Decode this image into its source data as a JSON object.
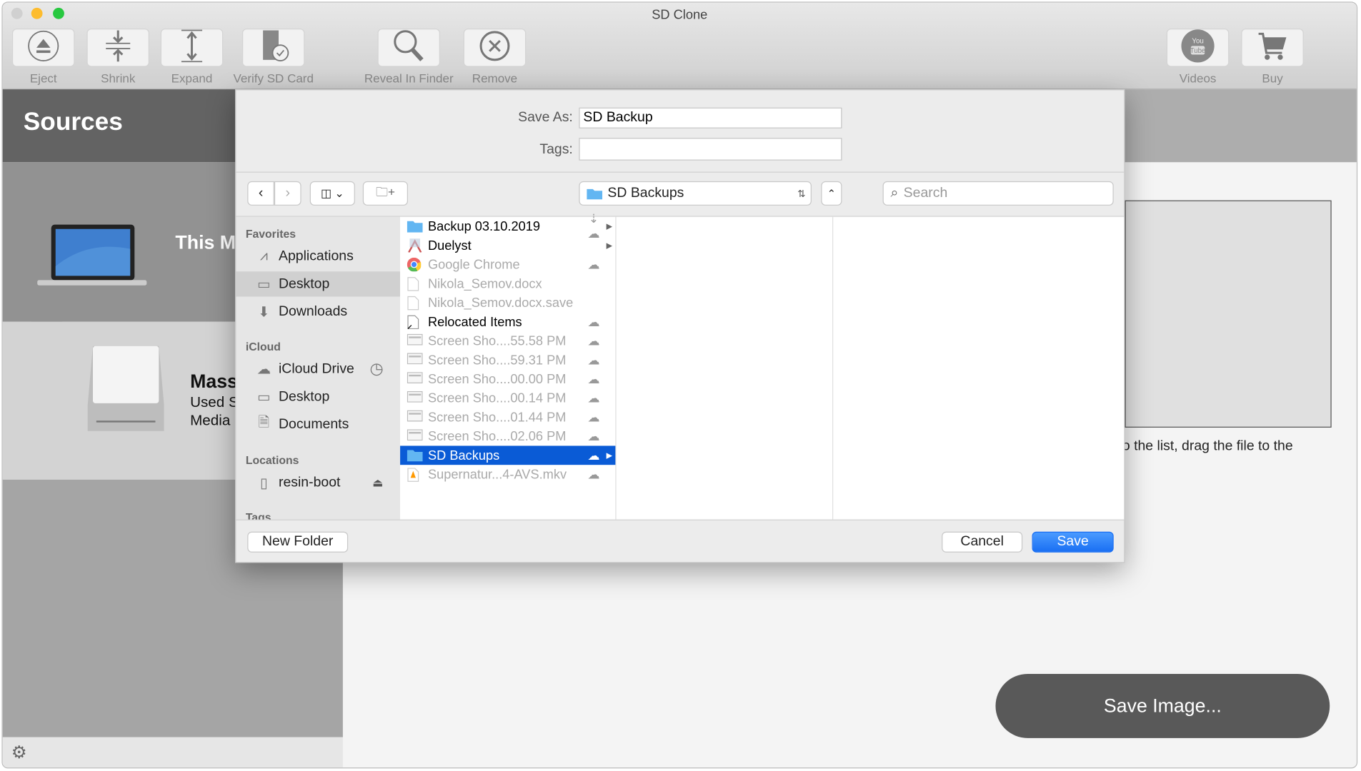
{
  "window": {
    "title": "SD Clone"
  },
  "toolbar": {
    "left": [
      {
        "label": "Eject",
        "icon": "eject-icon"
      },
      {
        "label": "Shrink",
        "icon": "shrink-icon"
      },
      {
        "label": "Expand",
        "icon": "expand-icon"
      },
      {
        "label": "Verify SD Card",
        "icon": "verify-sd-icon"
      },
      {
        "label": "Reveal In Finder",
        "icon": "magnifier-icon"
      },
      {
        "label": "Remove",
        "icon": "remove-icon"
      }
    ],
    "right": [
      {
        "label": "Videos",
        "icon": "youtube-icon"
      },
      {
        "label": "Buy",
        "icon": "cart-icon"
      }
    ]
  },
  "sources": {
    "title": "Sources",
    "items": [
      {
        "name": "This M"
      },
      {
        "name": "Mass",
        "line1": "Used S",
        "line2": "Media"
      }
    ]
  },
  "main": {
    "hint": "o the list, drag the file to the",
    "save_image": "Save Image..."
  },
  "dialog": {
    "save_as_label": "Save As:",
    "save_as_value": "SD Backup",
    "tags_label": "Tags:",
    "tags_value": "",
    "location": "SD Backups",
    "search_placeholder": "Search",
    "sidebar": {
      "favorites": "Favorites",
      "fav_items": [
        "Applications",
        "Desktop",
        "Downloads"
      ],
      "icloud": "iCloud",
      "icloud_items": [
        "iCloud Drive",
        "Desktop",
        "Documents"
      ],
      "locations": "Locations",
      "loc_items": [
        "resin-boot"
      ],
      "tags": "Tags",
      "selected": "Desktop"
    },
    "files": [
      {
        "name": "Backup 03.10.2019",
        "type": "folder",
        "cloud": "download",
        "arrow": true,
        "dim": false
      },
      {
        "name": "Duelyst",
        "type": "app",
        "cloud": "",
        "arrow": true,
        "dim": false
      },
      {
        "name": "Google Chrome",
        "type": "chrome",
        "cloud": "cloud",
        "arrow": false,
        "dim": true
      },
      {
        "name": "Nikola_Semov.docx",
        "type": "doc",
        "cloud": "",
        "arrow": false,
        "dim": true
      },
      {
        "name": "Nikola_Semov.docx.save",
        "type": "doc",
        "cloud": "",
        "arrow": false,
        "dim": true
      },
      {
        "name": "Relocated Items",
        "type": "alias",
        "cloud": "cloud",
        "arrow": false,
        "dim": false
      },
      {
        "name": "Screen Sho....55.58 PM",
        "type": "image",
        "cloud": "cloud",
        "arrow": false,
        "dim": true
      },
      {
        "name": "Screen Sho....59.31 PM",
        "type": "image",
        "cloud": "cloud",
        "arrow": false,
        "dim": true
      },
      {
        "name": "Screen Sho....00.00 PM",
        "type": "image",
        "cloud": "cloud",
        "arrow": false,
        "dim": true
      },
      {
        "name": "Screen Sho....00.14 PM",
        "type": "image",
        "cloud": "cloud",
        "arrow": false,
        "dim": true
      },
      {
        "name": "Screen Sho....01.44 PM",
        "type": "image",
        "cloud": "cloud",
        "arrow": false,
        "dim": true
      },
      {
        "name": "Screen Sho....02.06 PM",
        "type": "image",
        "cloud": "cloud",
        "arrow": false,
        "dim": true
      },
      {
        "name": "SD Backups",
        "type": "folder",
        "cloud": "cloud",
        "arrow": true,
        "dim": false,
        "selected": true
      },
      {
        "name": "Supernatur...4-AVS.mkv",
        "type": "video",
        "cloud": "cloud",
        "arrow": false,
        "dim": true
      }
    ],
    "new_folder": "New Folder",
    "cancel": "Cancel",
    "save": "Save"
  },
  "colors": {
    "accent": "#0a5bd6",
    "save_button": "#1a78f5",
    "sources_header": "#636363"
  }
}
